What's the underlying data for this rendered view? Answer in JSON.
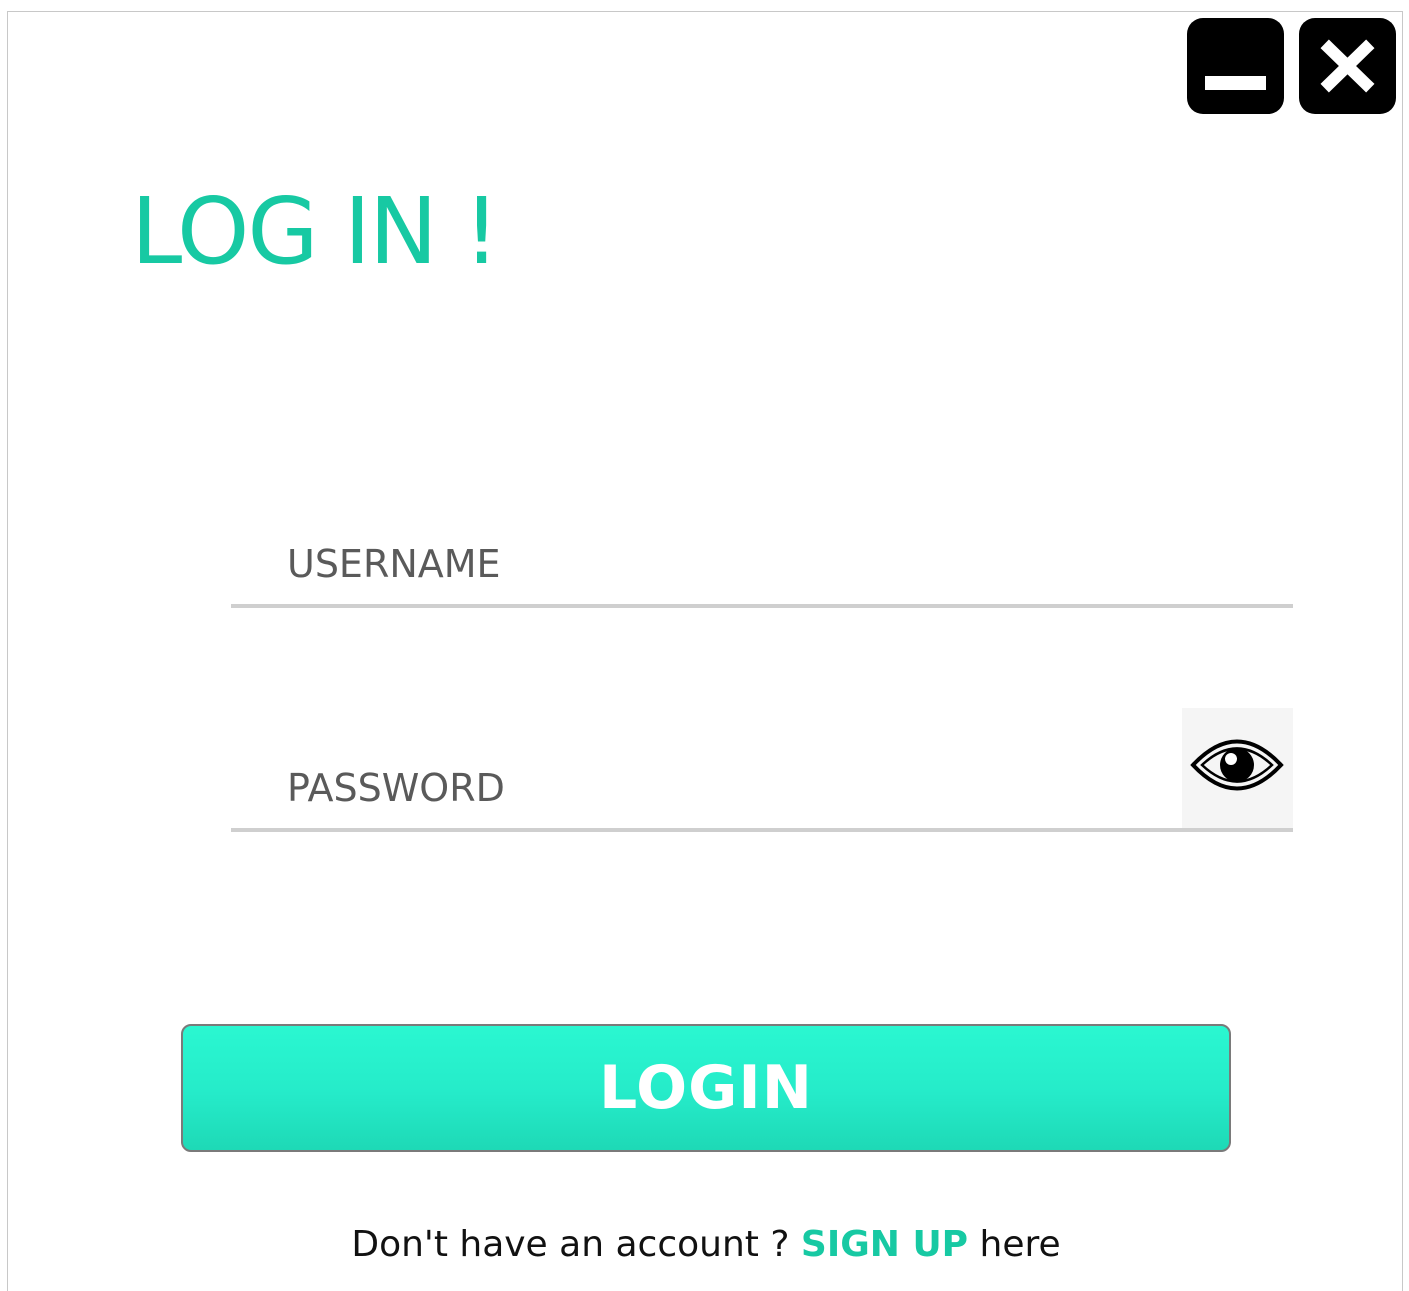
{
  "window": {
    "minimize_icon": "minimize-icon",
    "close_icon": "close-icon"
  },
  "title": "LOG IN !",
  "username": {
    "placeholder": "USERNAME",
    "value": ""
  },
  "password": {
    "placeholder": "PASSWORD",
    "value": "",
    "toggle_icon": "eye-icon"
  },
  "login_button": {
    "label": "LOGIN"
  },
  "signup": {
    "prompt": "Don't have an account ?",
    "link_label": "SIGN UP",
    "suffix": "here"
  },
  "colors": {
    "accent": "#17c9a3",
    "button_top": "#2af7d1",
    "button_bottom": "#1ed9b6",
    "window_buttons": "#000000"
  }
}
